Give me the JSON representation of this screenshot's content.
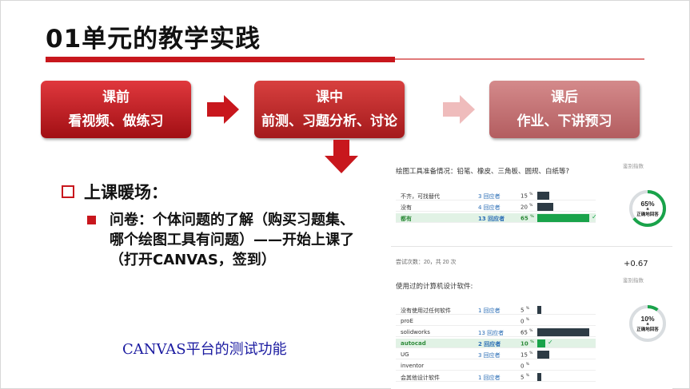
{
  "title": "01单元的教学实践",
  "stages": [
    {
      "line1": "课前",
      "line2": "看视频、做练习"
    },
    {
      "line1": "课中",
      "line2": "前测、习题分析、讨论"
    },
    {
      "line1": "课后",
      "line2": "作业、下讲预习"
    }
  ],
  "bullet_main": "上课暖场：",
  "sub_bullet": "问卷：个体问题的了解（购买习题集、哪个绘图工具有问题）——开始上课了（打开CANVAS，签到）",
  "caption": "CANVAS平台的测试功能",
  "panels": [
    {
      "discrimination": "鉴别指数",
      "question": "绘图工具准备情况：铅笔、橡皮、三角板、圆规、白纸等?",
      "rows": [
        {
          "label": "不齐，可找替代",
          "count": "3 回应者",
          "pct": "15",
          "value": 15,
          "highlight": false
        },
        {
          "label": "没有",
          "count": "4 回应者",
          "pct": "20",
          "value": 20,
          "highlight": false
        },
        {
          "label": "都有",
          "count": "13 回应者",
          "pct": "65",
          "value": 65,
          "highlight": true
        }
      ],
      "donut": {
        "value": 65,
        "pct": "65%",
        "a": "a",
        "label": "正确地回答"
      }
    },
    {
      "attempts": "尝试次数：20，共 20 次",
      "score": "+0.67",
      "discrimination": "鉴别指数",
      "question": "使用过的计算机设计软件:",
      "rows": [
        {
          "label": "没有使用过任何软件",
          "count": "1 回应者",
          "pct": "5",
          "value": 5,
          "highlight": false
        },
        {
          "label": "proE",
          "count": "",
          "pct": "0",
          "value": 0,
          "highlight": false
        },
        {
          "label": "solidworks",
          "count": "13 回应者",
          "pct": "65",
          "value": 65,
          "highlight": false
        },
        {
          "label": "autocad",
          "count": "2 回应者",
          "pct": "10",
          "value": 10,
          "highlight": true
        },
        {
          "label": "UG",
          "count": "3 回应者",
          "pct": "15",
          "value": 15,
          "highlight": false
        },
        {
          "label": "inventor",
          "count": "",
          "pct": "0",
          "value": 0,
          "highlight": false
        },
        {
          "label": "会其他设计软件",
          "count": "1 回应者",
          "pct": "5",
          "value": 5,
          "highlight": false
        }
      ],
      "donut": {
        "value": 10,
        "pct": "10%",
        "a": "a",
        "label": "正确地回答"
      }
    }
  ],
  "colors": {
    "accent": "#c8171d",
    "correct": "#19a34a",
    "bar": "#2d3b45"
  }
}
